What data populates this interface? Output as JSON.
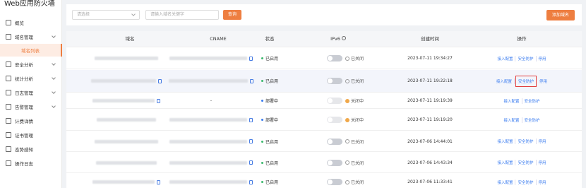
{
  "app": {
    "brand": "Web应用防火墙"
  },
  "sidebar": {
    "items": [
      {
        "label": "概览",
        "icon": "overview-icon"
      },
      {
        "label": "域名管理",
        "icon": "domain-icon"
      },
      {
        "label": "域名列表",
        "icon": ""
      },
      {
        "label": "安全分析",
        "icon": "analysis-icon"
      },
      {
        "label": "统计分析",
        "icon": "stats-icon"
      },
      {
        "label": "日志管理",
        "icon": "log-icon"
      },
      {
        "label": "告警管理",
        "icon": "alarm-icon"
      },
      {
        "label": "计费详情",
        "icon": "billing-icon"
      },
      {
        "label": "证书管理",
        "icon": "cert-icon"
      },
      {
        "label": "态势感知",
        "icon": "situation-icon"
      },
      {
        "label": "操作日志",
        "icon": "oplog-icon"
      }
    ]
  },
  "toolbar": {
    "select_placeholder": "请选择",
    "search_placeholder": "请输入域名关键字",
    "search_label": "查询",
    "add_label": "添加域名"
  },
  "table": {
    "headers": {
      "domain": "域名",
      "cname": "CNAME",
      "status": "状态",
      "ipv6": "IPv6",
      "created": "创建时间",
      "ops": "操作"
    },
    "rows": [
      {
        "status": "已启用",
        "ipv6_toggle": "关",
        "ipv6": "已关闭",
        "created": "2023-07-11 19:34:27",
        "ops": [
          "接入配置",
          "安全防护",
          "停用"
        ]
      },
      {
        "status": "已启用",
        "ipv6_toggle": "关",
        "ipv6": "已关闭",
        "created": "2023-07-11 19:22:18",
        "ops": [
          "接入配置",
          "安全防护",
          "停用"
        ]
      },
      {
        "status": "部署中",
        "ipv6_toggle": "关",
        "ipv6": "关闭中",
        "created": "2023-07-11 19:19:39",
        "ops": [
          "接入配置",
          "安全防护"
        ]
      },
      {
        "status": "部署中",
        "ipv6_toggle": "关",
        "ipv6": "关闭中",
        "created": "2023-07-11 19:19:20",
        "ops": [
          "接入配置",
          "安全防护"
        ]
      },
      {
        "status": "已启用",
        "ipv6_toggle": "关",
        "ipv6": "已关闭",
        "created": "2023-07-06 14:44:01",
        "ops": [
          "接入配置",
          "安全防护",
          "停用"
        ]
      },
      {
        "status": "已启用",
        "ipv6_toggle": "关",
        "ipv6": "已关闭",
        "created": "2023-07-06 14:43:34",
        "ops": [
          "接入配置",
          "安全防护",
          "停用"
        ]
      },
      {
        "status": "已启用",
        "ipv6_toggle": "关",
        "ipv6": "已关闭",
        "created": "2023-07-06 11:33:41",
        "ops": [
          "接入配置",
          "安全防护",
          "停用"
        ]
      }
    ],
    "cname_dash": "-"
  },
  "colors": {
    "accent": "#ee7e40",
    "link": "#3a7cf0",
    "highlight_box": "#e23c3c"
  }
}
